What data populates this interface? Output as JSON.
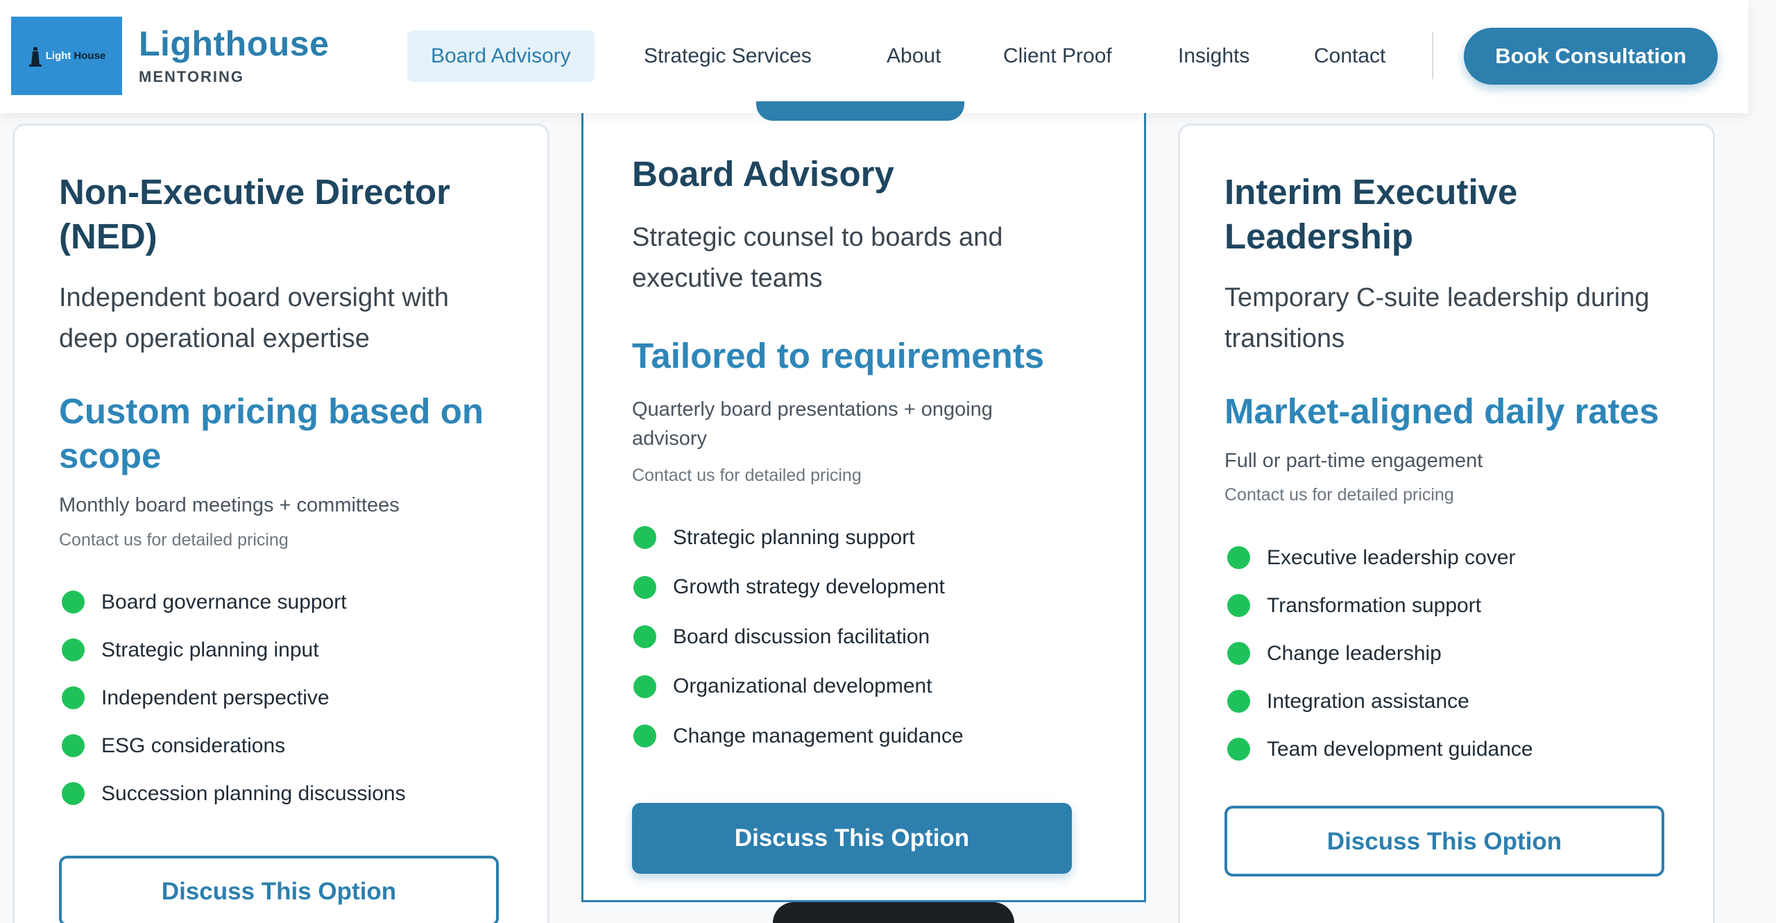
{
  "brand": {
    "logo_text_a": "Light",
    "logo_text_b": "House",
    "name": "Lighthouse",
    "subtitle": "MENTORING"
  },
  "nav": {
    "items": [
      "Board Advisory",
      "Strategic Services",
      "About",
      "Client Proof",
      "Insights",
      "Contact"
    ],
    "active": "Board Advisory",
    "cta": "Book Consultation"
  },
  "cards": [
    {
      "title_line1": "Non-Executive Director",
      "title_line2": "(NED)",
      "desc_line1": "Independent board oversight with",
      "desc_line2": "deep operational expertise",
      "price_line1": "Custom pricing based on",
      "price_line2": "scope",
      "frequency": "Monthly board meetings + committees",
      "note": "Contact us for detailed pricing",
      "features": [
        "Board governance support",
        "Strategic planning input",
        "Independent perspective",
        "ESG considerations",
        "Succession planning discussions"
      ],
      "button": "Discuss This Option"
    },
    {
      "title_line1": "Board Advisory",
      "desc_line1": "Strategic counsel to boards and",
      "desc_line2": "executive teams",
      "price_line1": "Tailored to requirements",
      "frequency_line1": "Quarterly board presentations + ongoing",
      "frequency_line2": "advisory",
      "note": "Contact us for detailed pricing",
      "features": [
        "Strategic planning support",
        "Growth strategy development",
        "Board discussion facilitation",
        "Organizational development",
        "Change management guidance"
      ],
      "button": "Discuss This Option"
    },
    {
      "title_line1": "Interim Executive",
      "title_line2": "Leadership",
      "desc_line1": "Temporary C-suite leadership during",
      "desc_line2": "transitions",
      "price_line1": "Market-aligned daily rates",
      "frequency": "Full or part-time engagement",
      "note": "Contact us for detailed pricing",
      "features": [
        "Executive leadership cover",
        "Transformation support",
        "Change leadership",
        "Integration assistance",
        "Team development guidance"
      ],
      "button": "Discuss This Option"
    }
  ],
  "colors": {
    "accent": "#2d7fae",
    "feature_dot": "#1fc25a",
    "title": "#1e4660"
  }
}
